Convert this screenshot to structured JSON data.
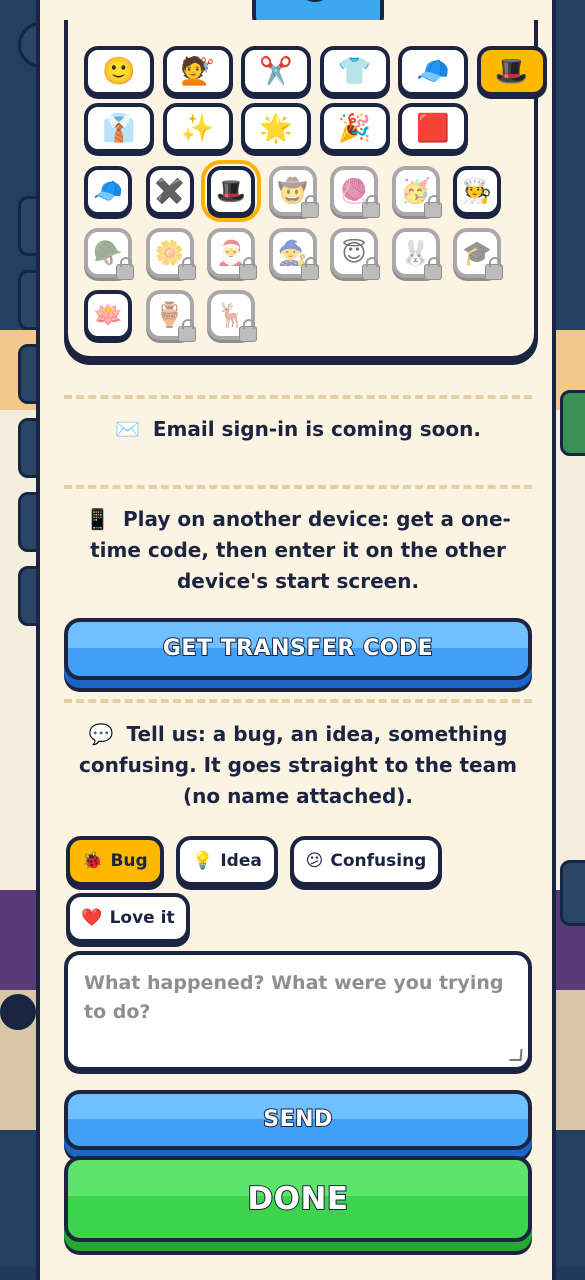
{
  "cosmetics": {
    "row1": [
      {
        "name": "face-icon",
        "glyph": "🙂",
        "state": "normal"
      },
      {
        "name": "haircut-icon",
        "glyph": "💇",
        "state": "normal"
      },
      {
        "name": "scissors-icon",
        "glyph": "✂️",
        "state": "normal"
      },
      {
        "name": "shirt-icon",
        "glyph": "👕",
        "state": "normal"
      },
      {
        "name": "cap-icon",
        "glyph": "🧢",
        "state": "normal"
      },
      {
        "name": "top-hat-icon",
        "glyph": "🎩",
        "state": "selected"
      }
    ],
    "row2": [
      {
        "name": "suit-icon",
        "glyph": "👔",
        "state": "normal"
      },
      {
        "name": "sparkles-icon",
        "glyph": "✨",
        "state": "normal"
      },
      {
        "name": "star-icon",
        "glyph": "🌟",
        "state": "normal"
      },
      {
        "name": "party-popper-icon",
        "glyph": "🎉",
        "state": "normal"
      },
      {
        "name": "red-square-icon",
        "glyph": "🟥",
        "state": "normal"
      }
    ],
    "row3": [
      {
        "name": "cap-icon",
        "glyph": "🧢",
        "state": "normal"
      },
      {
        "name": "none-x-icon",
        "glyph": "✖️",
        "state": "normal"
      },
      {
        "name": "top-hat-icon",
        "glyph": "🎩",
        "state": "equipped"
      },
      {
        "name": "cowboy-face-icon",
        "glyph": "🤠",
        "state": "locked"
      },
      {
        "name": "yarn-icon",
        "glyph": "🧶",
        "state": "locked"
      },
      {
        "name": "party-face-icon",
        "glyph": "🥳",
        "state": "locked"
      },
      {
        "name": "chef-icon",
        "glyph": "🧑‍🍳",
        "state": "normal"
      }
    ],
    "row4": [
      {
        "name": "military-helmet-icon",
        "glyph": "🪖",
        "state": "locked"
      },
      {
        "name": "flower-icon",
        "glyph": "🌼",
        "state": "locked"
      },
      {
        "name": "santa-icon",
        "glyph": "🎅",
        "state": "locked"
      },
      {
        "name": "witch-icon",
        "glyph": "🧙",
        "state": "locked"
      },
      {
        "name": "halo-face-icon",
        "glyph": "😇",
        "state": "locked"
      },
      {
        "name": "rabbit-icon",
        "glyph": "🐰",
        "state": "locked"
      },
      {
        "name": "graduation-cap-icon",
        "glyph": "🎓",
        "state": "locked"
      }
    ],
    "row5": [
      {
        "name": "lotus-icon",
        "glyph": "🪷",
        "state": "normal"
      },
      {
        "name": "vase-icon",
        "glyph": "🏺",
        "state": "locked"
      },
      {
        "name": "deer-icon",
        "glyph": "🦌",
        "state": "locked"
      }
    ]
  },
  "email": {
    "icon": "✉️",
    "text": "Email sign-in is coming soon."
  },
  "transfer": {
    "icon": "📱",
    "text": "Play on another device: get a one-time code, then enter it on the other device's start screen.",
    "button": "GET TRANSFER CODE"
  },
  "feedback": {
    "icon": "💬",
    "text": "Tell us: a bug, an idea, something confusing. It goes straight to the team (no name attached).",
    "chips": [
      {
        "icon": "🐞",
        "label": "Bug",
        "active": true
      },
      {
        "icon": "💡",
        "label": "Idea",
        "active": false
      },
      {
        "icon": "😕",
        "label": "Confusing",
        "active": false
      },
      {
        "icon": "❤️",
        "label": "Love it",
        "active": false
      }
    ],
    "placeholder": "What happened? What were you trying to do?",
    "send": "SEND"
  },
  "done": "DONE"
}
